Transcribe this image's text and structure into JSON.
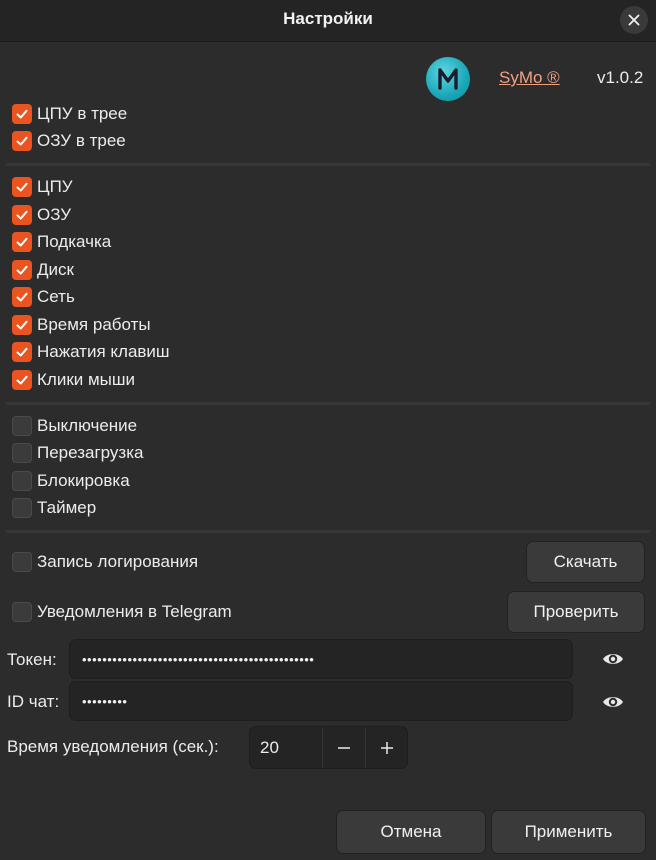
{
  "window": {
    "title": "Настройки"
  },
  "brand": {
    "link_text": "SyMo ®",
    "version": "v1.0.2"
  },
  "tree_options": [
    {
      "label": "ЦПУ в трее",
      "checked": true
    },
    {
      "label": "ОЗУ в трее",
      "checked": true
    }
  ],
  "monitor_options": [
    {
      "label": "ЦПУ",
      "checked": true
    },
    {
      "label": "ОЗУ",
      "checked": true
    },
    {
      "label": "Подкачка",
      "checked": true
    },
    {
      "label": "Диск",
      "checked": true
    },
    {
      "label": "Сеть",
      "checked": true
    },
    {
      "label": "Время работы",
      "checked": true
    },
    {
      "label": "Нажатия клавиш",
      "checked": true
    },
    {
      "label": "Клики мыши",
      "checked": true
    }
  ],
  "power_options": [
    {
      "label": "Выключение",
      "checked": false
    },
    {
      "label": "Перезагрузка",
      "checked": false
    },
    {
      "label": "Блокировка",
      "checked": false
    },
    {
      "label": "Таймер",
      "checked": false
    }
  ],
  "logging": {
    "label": "Запись логирования",
    "checked": false,
    "button": "Скачать"
  },
  "telegram": {
    "label": "Уведомления в Telegram",
    "checked": false,
    "button": "Проверить",
    "token_label": "Токен:",
    "token_value": "••••••••••••••••••••••••••••••••••••••••••••••",
    "chat_label": "ID чат:",
    "chat_value": "•••••••••",
    "interval_label": "Время уведомления (сек.):",
    "interval_value": "20"
  },
  "footer": {
    "cancel": "Отмена",
    "apply": "Применить"
  },
  "colors": {
    "accent": "#e95420",
    "link": "#f0a080",
    "logo": "#1aa7b8"
  }
}
